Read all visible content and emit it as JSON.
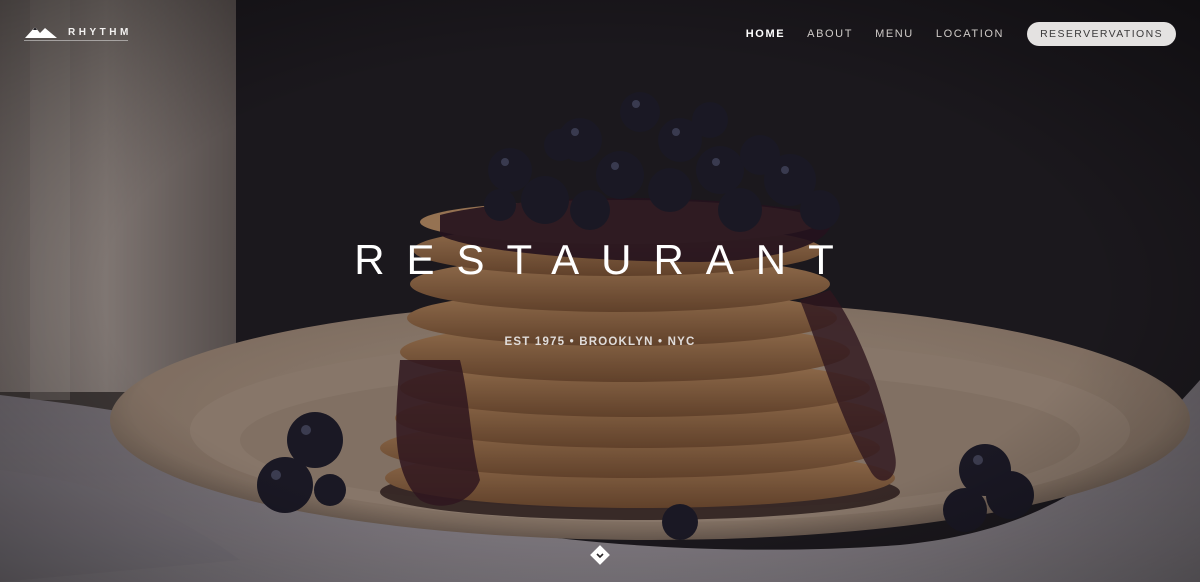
{
  "brand": {
    "name": "RHYTHM",
    "logo_icon": "mountain-icon"
  },
  "nav": {
    "items": [
      {
        "label": "HOME",
        "active": true
      },
      {
        "label": "ABOUT",
        "active": false
      },
      {
        "label": "MENU",
        "active": false
      },
      {
        "label": "LOCATION",
        "active": false
      }
    ],
    "reserve_label": "RESERVERVATIONS"
  },
  "hero": {
    "headline": "RESTAURANT",
    "tagline": "EST 1975 • BROOKLYN • NYC",
    "scroll_icon": "chevron-down-icon"
  },
  "colors": {
    "background": "#1b1a1d",
    "plate": "#b8a48f",
    "pancake": "#b08152",
    "cloth": "#8a868c",
    "reserve_button": "#e4e2e1"
  }
}
